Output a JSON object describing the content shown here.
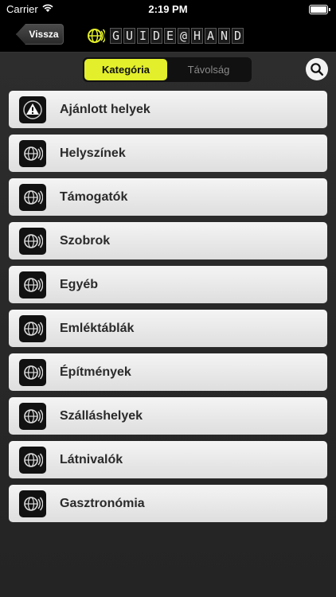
{
  "status": {
    "carrier": "Carrier",
    "time": "2:19 PM"
  },
  "nav": {
    "back_label": "Vissza",
    "logo_letters": [
      "G",
      "U",
      "I",
      "D",
      "E",
      "@",
      "H",
      "A",
      "N",
      "D"
    ],
    "accent": "#e2ef2a"
  },
  "segments": {
    "active": "Kategória",
    "inactive": "Távolság"
  },
  "categories": [
    {
      "label": "Ajánlott helyek",
      "icon": "warning-icon"
    },
    {
      "label": "Helyszínek",
      "icon": "globe-sound-icon"
    },
    {
      "label": "Támogatók",
      "icon": "globe-sound-icon"
    },
    {
      "label": "Szobrok",
      "icon": "globe-sound-icon"
    },
    {
      "label": "Egyéb",
      "icon": "globe-sound-icon"
    },
    {
      "label": "Emléktáblák",
      "icon": "globe-sound-icon"
    },
    {
      "label": "Építmények",
      "icon": "globe-sound-icon"
    },
    {
      "label": "Szálláshelyek",
      "icon": "globe-sound-icon"
    },
    {
      "label": "Látnivalók",
      "icon": "globe-sound-icon"
    },
    {
      "label": "Gasztronómia",
      "icon": "globe-sound-icon"
    }
  ]
}
